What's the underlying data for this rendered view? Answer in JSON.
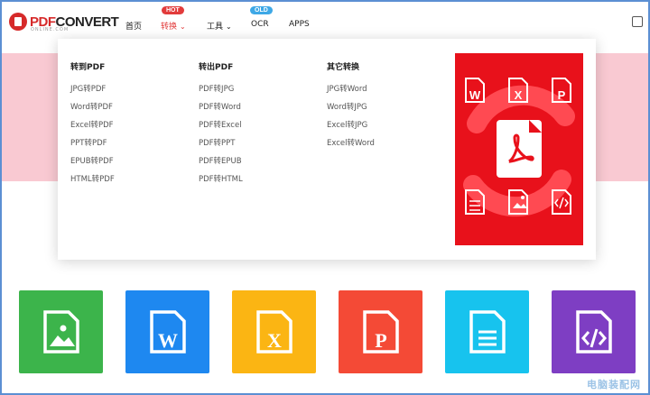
{
  "logo": {
    "pdf": "PDF",
    "convert": "CONVERT",
    "tagline": "ONLINE.COM"
  },
  "nav": {
    "items": [
      {
        "label": "首页"
      },
      {
        "label": "转换",
        "badge": "HOT",
        "chevron": "⌄"
      },
      {
        "label": "工具",
        "chevron": "⌄"
      },
      {
        "label": "OCR",
        "badge": "OLD"
      },
      {
        "label": "APPS"
      }
    ]
  },
  "dropdown": {
    "columns": [
      {
        "title": "转到PDF",
        "links": [
          "JPG转PDF",
          "Word转PDF",
          "Excel转PDF",
          "PPT转PDF",
          "EPUB转PDF",
          "HTML转PDF"
        ]
      },
      {
        "title": "转出PDF",
        "links": [
          "PDF转JPG",
          "PDF转Word",
          "PDF转Excel",
          "PDF转PPT",
          "PDF转EPUB",
          "PDF转HTML"
        ]
      },
      {
        "title": "其它转换",
        "links": [
          "JPG转Word",
          "Word转JPG",
          "Excel转JPG",
          "Excel转Word"
        ]
      }
    ],
    "promo": {
      "letters": [
        "W",
        "X",
        "P"
      ],
      "bg": "#e8111b"
    }
  },
  "tiles": [
    {
      "icon": "image-file-icon",
      "color": "#3cb44b"
    },
    {
      "icon": "word-file-icon",
      "letter": "W",
      "color": "#1e88f0"
    },
    {
      "icon": "excel-file-icon",
      "letter": "X",
      "color": "#fbb513"
    },
    {
      "icon": "powerpoint-file-icon",
      "letter": "P",
      "color": "#f44a36"
    },
    {
      "icon": "text-file-icon",
      "color": "#17c3ee"
    },
    {
      "icon": "code-file-icon",
      "color": "#7e3ec3"
    }
  ],
  "watermark": "电脑装配网"
}
